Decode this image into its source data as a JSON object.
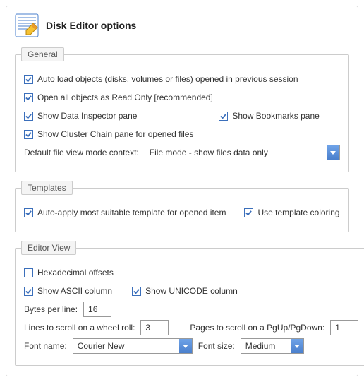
{
  "header": {
    "title": "Disk Editor options"
  },
  "general": {
    "legend": "General",
    "auto_load": "Auto load objects (disks, volumes or files) opened in previous session",
    "read_only": "Open all objects as Read Only [recommended]",
    "data_inspector": "Show Data Inspector pane",
    "bookmarks": "Show Bookmarks pane",
    "cluster_chain": "Show Cluster Chain pane for opened files",
    "view_mode_label": "Default file view mode context:",
    "view_mode_value": "File mode - show files data only"
  },
  "templates": {
    "legend": "Templates",
    "auto_apply": "Auto-apply most suitable template for opened item",
    "coloring": "Use template coloring"
  },
  "editor": {
    "legend": "Editor View",
    "hex_offsets": "Hexadecimal offsets",
    "ascii": "Show ASCII column",
    "unicode": "Show UNICODE column",
    "bytes_label": "Bytes per line:",
    "bytes_value": "16",
    "wheel_label": "Lines to scroll on a wheel roll:",
    "wheel_value": "3",
    "pages_label": "Pages to scroll on a PgUp/PgDown:",
    "pages_value": "1",
    "font_label": "Font name:",
    "font_value": "Courier New",
    "size_label": "Font size:",
    "size_value": "Medium"
  }
}
